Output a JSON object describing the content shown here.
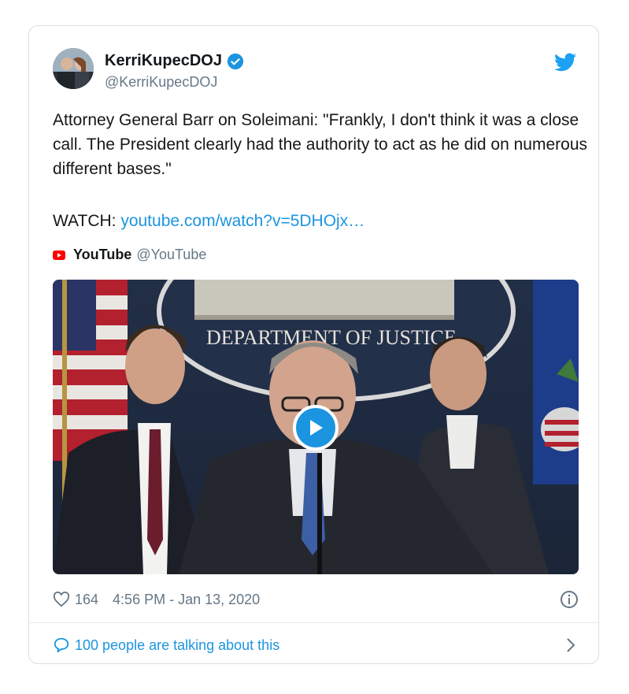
{
  "tweet": {
    "display_name": "KerriKupecDOJ",
    "handle": "@KerriKupecDOJ",
    "text": "Attorney General Barr on Soleimani: \"Frankly, I don't think it was a close call. The President clearly had the authority to act as he did on numerous different bases.\"",
    "watch_label": "WATCH:",
    "link_text": "youtube.com/watch?v=5DHOjx…"
  },
  "media": {
    "source_name": "YouTube",
    "source_handle": "@YouTube",
    "seal_text": "DEPARTMENT OF JUSTICE"
  },
  "footer": {
    "likes": "164",
    "timestamp": "4:56 PM - Jan 13, 2020",
    "talking": "100 people are talking about this"
  },
  "colors": {
    "accent": "#1b95e0",
    "secondary_text": "#657786",
    "youtube_red": "#ff0000"
  },
  "icons": [
    "verified-badge-icon",
    "twitter-bird-icon",
    "youtube-logo-icon",
    "play-icon",
    "heart-icon",
    "info-icon",
    "speech-bubble-icon",
    "chevron-right-icon"
  ]
}
